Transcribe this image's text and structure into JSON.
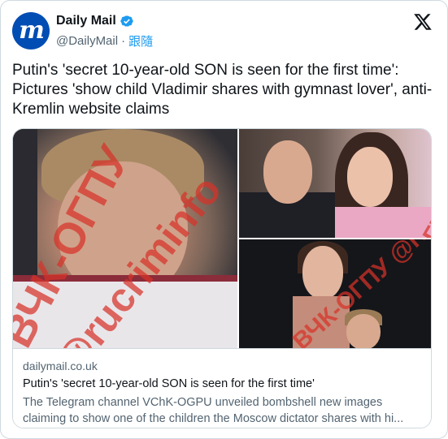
{
  "author": {
    "display_name": "Daily Mail",
    "handle": "@DailyMail",
    "separator": "·",
    "follow_label": "跟隨",
    "avatar_letter": "m",
    "verified": true,
    "icon": "verified-badge-icon"
  },
  "platform_logo": "x-logo-icon",
  "tweet": {
    "text": "Putin's 'secret 10-year-old SON is seen for the first time': Pictures 'show child Vladimir shares with gymnast lover', anti-Kremlin website claims"
  },
  "media": {
    "watermark_main_1": "ВЧК-ОГПУ",
    "watermark_main_2": "@rucriminfo",
    "watermark_tr": "ВЧК-ОГПУ",
    "watermark_br": "ВЧК-ОГПУ @rucriminalinfo"
  },
  "link_card": {
    "domain": "dailymail.co.uk",
    "title": "Putin's 'secret 10-year-old SON is seen for the first time'",
    "description_line1": "The Telegram channel VChK-OGPU unveiled bombshell new images",
    "description_line2": "claiming to show one of the children the Moscow dictator shares with hi..."
  },
  "colors": {
    "accent": "#1d9bf0",
    "brand": "#004db3",
    "text": "#0f1419",
    "muted": "#536471",
    "border": "#cfd9de",
    "watermark": "#d73228"
  }
}
